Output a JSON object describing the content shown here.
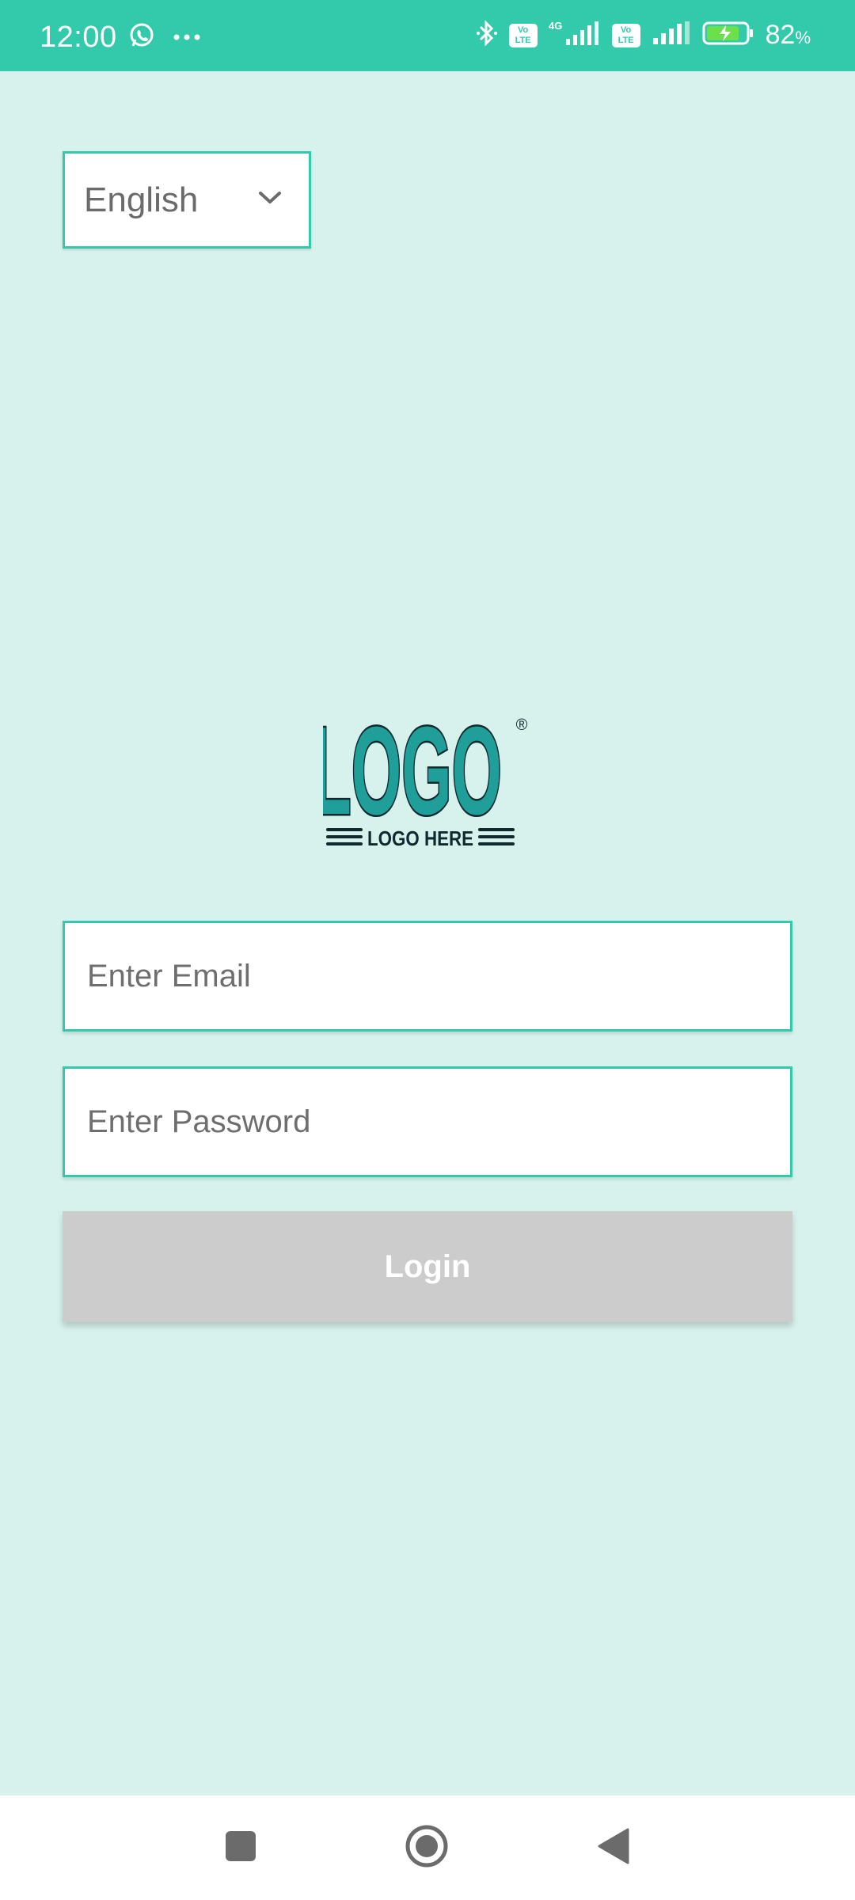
{
  "status_bar": {
    "time": "12:00",
    "battery_percent": "82",
    "battery_unit": "%",
    "network_label": "4G",
    "volte_label": "Vo LTE",
    "icons": [
      "whatsapp-icon",
      "more-dots-icon",
      "bluetooth-icon",
      "volte-icon",
      "signal-icon",
      "battery-charging-icon"
    ]
  },
  "language_selector": {
    "selected": "English",
    "icon": "chevron-down-icon"
  },
  "logo": {
    "wordmark": "LOGO",
    "tagline": "LOGO HERE",
    "registered_mark": "®",
    "colors": {
      "fill": "#1f9e9a",
      "outline": "#0f2a2e"
    }
  },
  "login_form": {
    "email_placeholder": "Enter Email",
    "password_placeholder": "Enter Password",
    "login_label": "Login"
  },
  "theme": {
    "accent": "#33c9ab",
    "background": "#d7f2ec",
    "disabled_button": "#cccccc"
  },
  "nav_bar": {
    "buttons": [
      "recents-icon",
      "home-icon",
      "back-icon"
    ]
  }
}
